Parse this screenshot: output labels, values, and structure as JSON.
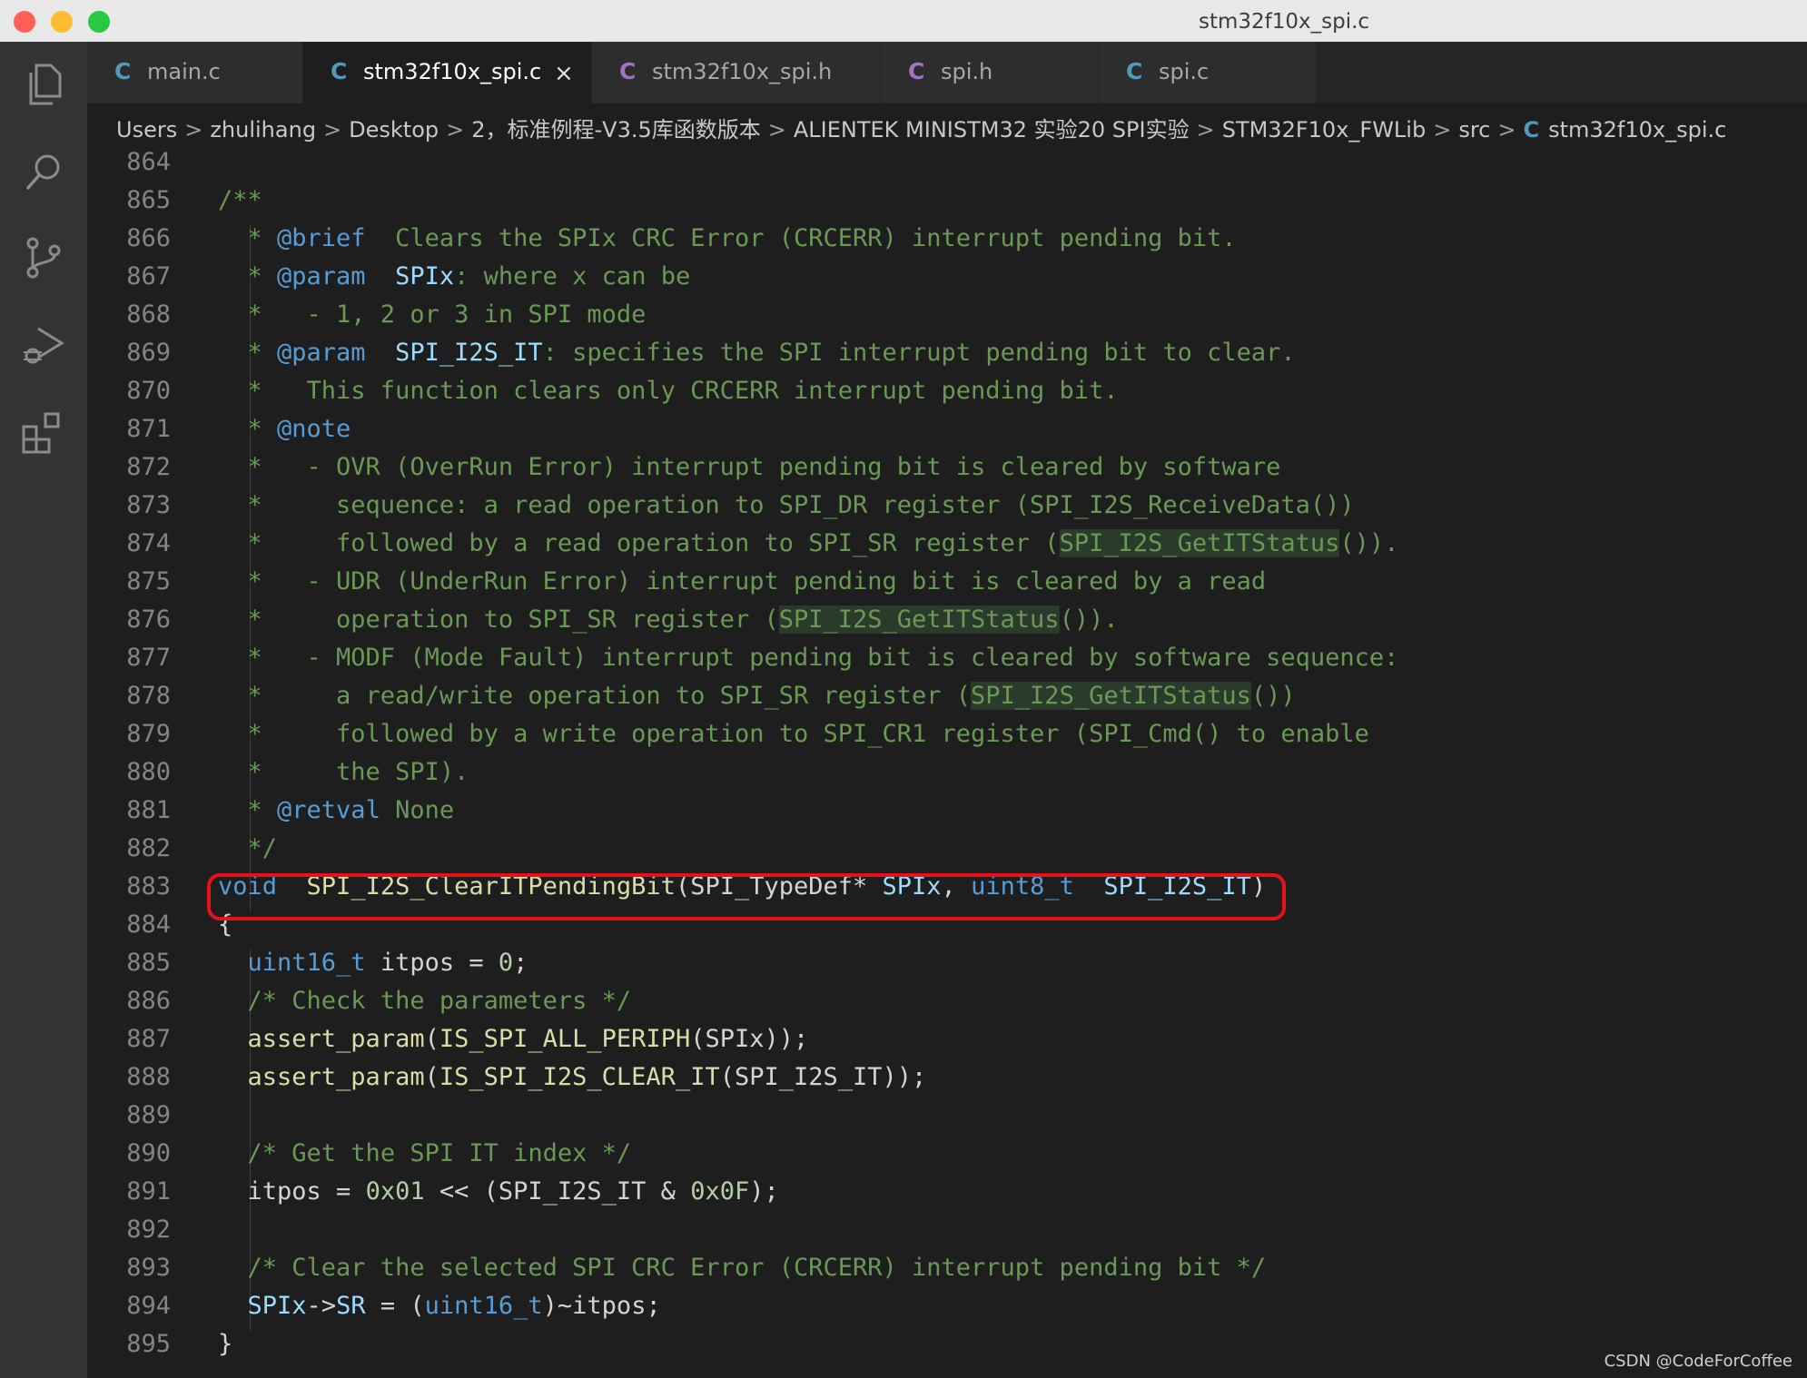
{
  "window": {
    "title": "stm32f10x_spi.c"
  },
  "activity_bar": {
    "icons": [
      "files-icon",
      "search-icon",
      "source-control-icon",
      "run-debug-icon",
      "extensions-icon"
    ]
  },
  "tabs": [
    {
      "icon": "C",
      "label": "main.c",
      "active": false,
      "color": "#519aba"
    },
    {
      "icon": "C",
      "label": "stm32f10x_spi.c",
      "active": true,
      "color": "#519aba"
    },
    {
      "icon": "C",
      "label": "stm32f10x_spi.h",
      "active": false,
      "color": "#a074c4"
    },
    {
      "icon": "C",
      "label": "spi.h",
      "active": false,
      "color": "#a074c4"
    },
    {
      "icon": "C",
      "label": "spi.c",
      "active": false,
      "color": "#519aba"
    }
  ],
  "tab_close": "×",
  "breadcrumb": {
    "items": [
      "Users",
      "zhulihang",
      "Desktop",
      "2，标准例程-V3.5库函数版本",
      "ALIENTEK MINISTM32 实验20 SPI实验",
      "STM32F10x_FWLib",
      "src"
    ],
    "file_icon": "C",
    "file": "stm32f10x_spi.c",
    "separator": ">"
  },
  "editor": {
    "line_numbers": [
      "864",
      "865",
      "866",
      "867",
      "868",
      "869",
      "870",
      "871",
      "872",
      "873",
      "874",
      "875",
      "876",
      "877",
      "878",
      "879",
      "880",
      "881",
      "882",
      "883",
      "884",
      "885",
      "886",
      "887",
      "888",
      "889",
      "890",
      "891",
      "892",
      "893",
      "894",
      "895"
    ],
    "lines": [
      [],
      [
        [
          "cm",
          "/**"
        ]
      ],
      [
        [
          "cm",
          "  * "
        ],
        [
          "tg",
          "@brief"
        ],
        [
          "cm",
          "  Clears the SPIx CRC Error (CRCERR) interrupt pending bit."
        ]
      ],
      [
        [
          "cm",
          "  * "
        ],
        [
          "tg",
          "@param"
        ],
        [
          "cm",
          "  "
        ],
        [
          "pm",
          "SPIx"
        ],
        [
          "cm",
          ": where x can be"
        ]
      ],
      [
        [
          "cm",
          "  *   - 1, 2 or 3 in SPI mode"
        ]
      ],
      [
        [
          "cm",
          "  * "
        ],
        [
          "tg",
          "@param"
        ],
        [
          "cm",
          "  "
        ],
        [
          "pm",
          "SPI_I2S_IT"
        ],
        [
          "cm",
          ": specifies the SPI interrupt pending bit to clear."
        ]
      ],
      [
        [
          "cm",
          "  *   This function clears only CRCERR interrupt pending bit."
        ]
      ],
      [
        [
          "cm",
          "  * "
        ],
        [
          "tg",
          "@note"
        ]
      ],
      [
        [
          "cm",
          "  *   - OVR (OverRun Error) interrupt pending bit is cleared by software"
        ]
      ],
      [
        [
          "cm",
          "  *     sequence: a read operation to SPI_DR register (SPI_I2S_ReceiveData())"
        ]
      ],
      [
        [
          "cm",
          "  *     followed by a read operation to SPI_SR register ("
        ],
        [
          "cm hl",
          "SPI_I2S_GetITStatus"
        ],
        [
          "cm",
          "())."
        ]
      ],
      [
        [
          "cm",
          "  *   - UDR (UnderRun Error) interrupt pending bit is cleared by a read"
        ]
      ],
      [
        [
          "cm",
          "  *     operation to SPI_SR register ("
        ],
        [
          "cm hl",
          "SPI_I2S_GetITStatus"
        ],
        [
          "cm",
          "())."
        ]
      ],
      [
        [
          "cm",
          "  *   - MODF (Mode Fault) interrupt pending bit is cleared by software sequence:"
        ]
      ],
      [
        [
          "cm",
          "  *     a read/write operation to SPI_SR register ("
        ],
        [
          "cm hl",
          "SPI_I2S_GetITStatus"
        ],
        [
          "cm",
          "())"
        ]
      ],
      [
        [
          "cm",
          "  *     followed by a write operation to SPI_CR1 register (SPI_Cmd() to enable"
        ]
      ],
      [
        [
          "cm",
          "  *     the SPI)."
        ]
      ],
      [
        [
          "cm",
          "  * "
        ],
        [
          "tg",
          "@retval"
        ],
        [
          "cm",
          " None"
        ]
      ],
      [
        [
          "cm",
          "  */"
        ]
      ],
      [
        [
          "kw",
          "void"
        ],
        [
          "",
          "  "
        ],
        [
          "fn",
          "SPI_I2S_ClearITPendingBit"
        ],
        [
          "",
          "(SPI_TypeDef* "
        ],
        [
          "pm",
          "SPIx"
        ],
        [
          "",
          ", "
        ],
        [
          "kw",
          "uint8_t"
        ],
        [
          "",
          "  "
        ],
        [
          "pm",
          "SPI_I2S_IT"
        ],
        [
          "",
          ")"
        ]
      ],
      [
        [
          "",
          "{"
        ]
      ],
      [
        [
          "",
          "  "
        ],
        [
          "kw",
          "uint16_t"
        ],
        [
          "",
          " itpos = "
        ],
        [
          "nb",
          "0"
        ],
        [
          "",
          ";"
        ]
      ],
      [
        [
          "",
          "  "
        ],
        [
          "cm",
          "/* Check the parameters */"
        ]
      ],
      [
        [
          "",
          "  "
        ],
        [
          "fn",
          "assert_param"
        ],
        [
          "",
          "("
        ],
        [
          "fn",
          "IS_SPI_ALL_PERIPH"
        ],
        [
          "",
          "(SPIx));"
        ]
      ],
      [
        [
          "",
          "  "
        ],
        [
          "fn",
          "assert_param"
        ],
        [
          "",
          "("
        ],
        [
          "fn",
          "IS_SPI_I2S_CLEAR_IT"
        ],
        [
          "",
          "(SPI_I2S_IT));"
        ]
      ],
      [],
      [
        [
          "",
          "  "
        ],
        [
          "cm",
          "/* Get the SPI IT index */"
        ]
      ],
      [
        [
          "",
          "  itpos = "
        ],
        [
          "nb",
          "0x01"
        ],
        [
          "",
          " << (SPI_I2S_IT & "
        ],
        [
          "nb",
          "0x0F"
        ],
        [
          "",
          ");"
        ]
      ],
      [],
      [
        [
          "",
          "  "
        ],
        [
          "cm",
          "/* Clear the selected SPI CRC Error (CRCERR) interrupt pending bit */"
        ]
      ],
      [
        [
          "",
          "  "
        ],
        [
          "pm",
          "SPIx"
        ],
        [
          "",
          "->"
        ],
        [
          "pm",
          "SR"
        ],
        [
          "",
          " = ("
        ],
        [
          "kw",
          "uint16_t"
        ],
        [
          "",
          ")~itpos;"
        ]
      ],
      [
        [
          "",
          "}"
        ]
      ]
    ]
  },
  "watermark": "CSDN @CodeForCoffee"
}
